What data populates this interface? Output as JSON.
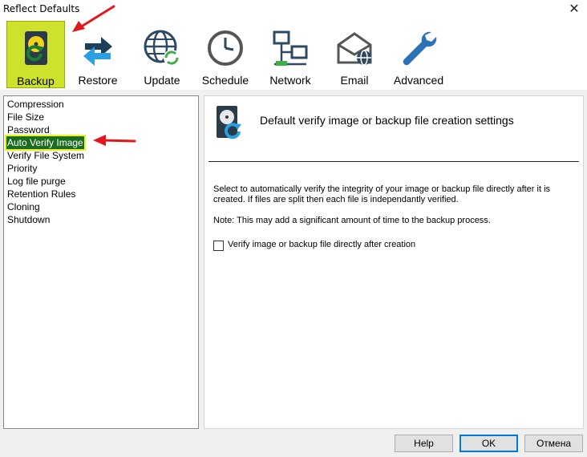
{
  "window": {
    "title": "Reflect Defaults"
  },
  "toolbar": {
    "items": [
      {
        "label": "Backup"
      },
      {
        "label": "Restore"
      },
      {
        "label": "Update"
      },
      {
        "label": "Schedule"
      },
      {
        "label": "Network"
      },
      {
        "label": "Email"
      },
      {
        "label": "Advanced"
      }
    ],
    "active": "Backup"
  },
  "sidebar": {
    "items": [
      {
        "label": "Compression"
      },
      {
        "label": "File Size"
      },
      {
        "label": "Password"
      },
      {
        "label": "Auto Verify Image"
      },
      {
        "label": "Verify File System"
      },
      {
        "label": "Priority"
      },
      {
        "label": "Log file purge"
      },
      {
        "label": "Retention Rules"
      },
      {
        "label": "Cloning"
      },
      {
        "label": "Shutdown"
      }
    ],
    "selected": "Auto Verify Image"
  },
  "panel": {
    "heading": "Default verify image or backup file creation settings",
    "description": "Select to automatically verify the integrity of your image or backup file directly after it is created. If files are split then each file is independantly verified.",
    "note": "Note: This may add a significant amount of time to the backup process.",
    "checkbox": {
      "label": "Verify image or backup file directly after creation",
      "checked": false
    }
  },
  "buttons": {
    "help": "Help",
    "ok": "OK",
    "cancel": "Отмена"
  },
  "colors": {
    "active_tool": "#cfe22b",
    "selected_item_bg": "#1c6c20",
    "selected_item_outline": "#eaf31c",
    "annotation_arrow": "#e3161d"
  }
}
